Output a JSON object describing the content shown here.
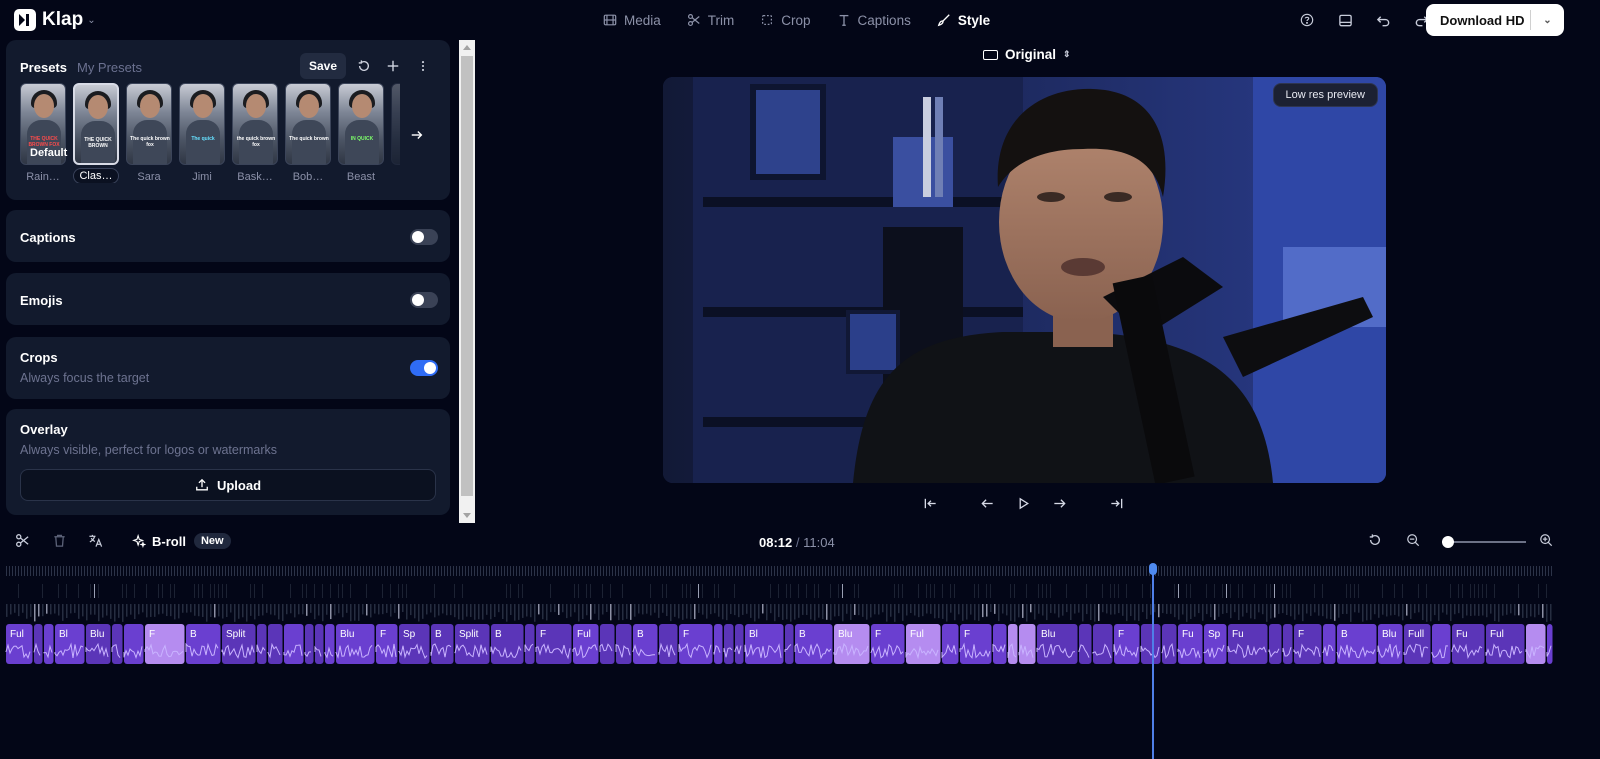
{
  "app": {
    "name": "Klap"
  },
  "nav": {
    "media": "Media",
    "trim": "Trim",
    "crop": "Crop",
    "captions": "Captions",
    "style": "Style",
    "active": "Style"
  },
  "header": {
    "download_label": "Download HD"
  },
  "presets": {
    "tab_presets": "Presets",
    "tab_my_presets": "My Presets",
    "save_label": "Save",
    "default_label": "Default",
    "items": [
      {
        "name": "Rain…",
        "caption": "THE QUICK BROWN FOX"
      },
      {
        "name": "Clas…",
        "caption": "THE QUICK BROWN"
      },
      {
        "name": "Sara",
        "caption": "The quick brown fox"
      },
      {
        "name": "Jimi",
        "caption": "The quick"
      },
      {
        "name": "Bask…",
        "caption": "the quick brown fox"
      },
      {
        "name": "Bob…",
        "caption": "The quick brown"
      },
      {
        "name": "Beast",
        "caption": "IN QUICK"
      }
    ],
    "selected": "Clas…"
  },
  "captions_card": {
    "title": "Captions",
    "enabled": false
  },
  "emojis_card": {
    "title": "Emojis",
    "enabled": false
  },
  "crops_card": {
    "title": "Crops",
    "subtitle": "Always focus the target",
    "enabled": true
  },
  "overlay_card": {
    "title": "Overlay",
    "subtitle": "Always visible, perfect for logos or watermarks",
    "upload_label": "Upload"
  },
  "preview": {
    "aspect_label": "Original",
    "badge": "Low res preview"
  },
  "timeline": {
    "broll_label": "B-roll",
    "broll_badge": "New",
    "current_time": "08:12",
    "separator": "/",
    "duration": "11:04",
    "zoom_level": 0.1,
    "playhead_fraction": 0.74,
    "clip_labels": [
      "Ful",
      "Bl",
      "Blu",
      "F",
      "B",
      "Split",
      "Blu",
      "F",
      "Sp",
      "B",
      "Split",
      "B",
      "F",
      "Ful",
      "B",
      "F",
      "Bl",
      "B",
      "Blu",
      "F",
      "Ful",
      "F",
      "Blu",
      "F",
      "Fu",
      "Sp",
      "Fu",
      "F",
      "B",
      "Blu",
      "Full",
      "Fu"
    ]
  },
  "colors": {
    "background": "#030617",
    "panel": "#121a2d",
    "accent": "#2f6cf5",
    "clip": "#6a3fd0",
    "clip_highlight": "#b58cf0",
    "playhead": "#4f7fe8"
  }
}
